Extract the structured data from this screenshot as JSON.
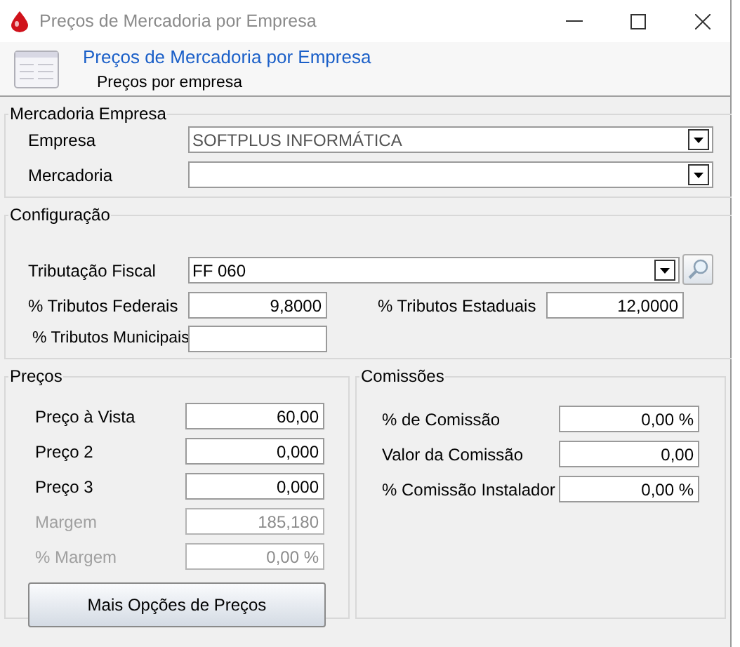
{
  "window": {
    "title": "Preços de Mercadoria por Empresa"
  },
  "header": {
    "title": "Preços de Mercadoria por Empresa",
    "subtitle": "Preços por empresa"
  },
  "mercadoria_empresa": {
    "title": "Mercadoria Empresa",
    "fields": [
      {
        "label": "Empresa",
        "value": "SOFTPLUS INFORMÁTICA",
        "kind": "combo"
      },
      {
        "label": "Mercadoria",
        "kind": "combo"
      }
    ]
  },
  "configuracao": {
    "title": "Configuração",
    "fields": [
      {
        "label": "Tributação Fiscal",
        "value": "FF 060",
        "kind": "combo_search"
      },
      {
        "label": "% Tributos Federais",
        "value": "9,8000",
        "kind": "number"
      },
      {
        "label": "% Tributos Estaduais",
        "value": "12,0000",
        "kind": "number"
      },
      {
        "label": "% Tributos Municipais",
        "kind": "number"
      }
    ]
  },
  "precos": {
    "title": "Preços",
    "fields": [
      {
        "label": "Preço à Vista",
        "value": "60,00",
        "disabled": false
      },
      {
        "label": "Preço 2",
        "value": "0,000",
        "disabled": false
      },
      {
        "label": "Preço 3",
        "value": "0,000",
        "disabled": false
      },
      {
        "label": "Margem",
        "value": "185,180",
        "disabled": true
      },
      {
        "label": "% Margem",
        "value": "0,00 %",
        "disabled": true
      }
    ],
    "button": "Mais Opções de Preços"
  },
  "comissoes": {
    "title": "Comissões",
    "fields": [
      {
        "label": "% de Comissão",
        "value": "0,00 %",
        "disabled": false
      },
      {
        "label": "Valor da Comissão",
        "value": "0,00",
        "disabled": false
      },
      {
        "label": "% Comissão Instalador",
        "value": "0,00 %",
        "disabled": false
      }
    ]
  }
}
